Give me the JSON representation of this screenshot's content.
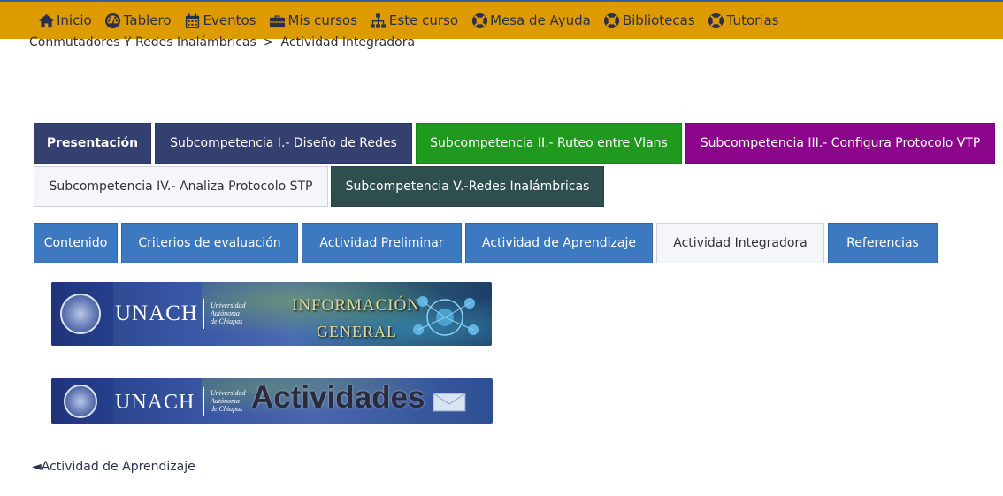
{
  "topnav": {
    "items": [
      {
        "label": "Inicio",
        "icon": "home-icon"
      },
      {
        "label": "Tablero",
        "icon": "dashboard-icon"
      },
      {
        "label": "Eventos",
        "icon": "calendar-icon"
      },
      {
        "label": "Mis cursos",
        "icon": "briefcase-icon"
      },
      {
        "label": "Este curso",
        "icon": "sitemap-icon"
      },
      {
        "label": "Mesa de Ayuda",
        "icon": "lifebuoy-icon"
      },
      {
        "label": "Bibliotecas",
        "icon": "lifebuoy-icon"
      },
      {
        "label": "Tutorias",
        "icon": "lifebuoy-icon"
      }
    ],
    "background": "#dd9b00"
  },
  "breadcrumb": {
    "course": "Conmutadores Y Redes Inalámbricas",
    "separator": ">",
    "current": "Actividad Integradora"
  },
  "section_tabs": [
    {
      "label": "Presentación",
      "bg": "#34406f",
      "color": "#ffffff",
      "bold": true
    },
    {
      "label": "Subcompetencia I.- Diseño de Redes",
      "bg": "#34406f",
      "color": "#ffffff"
    },
    {
      "label": "Subcompetencia II.- Ruteo entre Vlans",
      "bg": "#1f9a1f",
      "color": "#ffffff"
    },
    {
      "label": "Subcompetencia III.- Configura Protocolo VTP",
      "bg": "#8c068c",
      "color": "#ffffff"
    },
    {
      "label": "Subcompetencia IV.- Analiza Protocolo STP",
      "bg": "#f5f6f9",
      "color": "#333333"
    },
    {
      "label": "Subcompetencia V.-Redes Inalámbricas",
      "bg": "#2f4f4f",
      "color": "#ffffff"
    }
  ],
  "activity_tabs": [
    {
      "label": "Contenido",
      "active": false
    },
    {
      "label": "Criterios de evaluación",
      "active": false
    },
    {
      "label": "Actividad Preliminar",
      "active": false
    },
    {
      "label": "Actividad de Aprendizaje",
      "active": false
    },
    {
      "label": "Actividad Integradora",
      "active": true
    },
    {
      "label": "Referencias",
      "active": false
    }
  ],
  "colors": {
    "activity_tab_bg": "#3d79c0",
    "activity_tab_active_bg": "#f5f6f9"
  },
  "banners": [
    {
      "logo_text": "UNACH",
      "university_lines": [
        "Universidad",
        "Autónoma",
        "de Chiapas"
      ],
      "title_line1": "INFORMACIÓN",
      "title_line2": "GENERAL"
    },
    {
      "logo_text": "UNACH",
      "university_lines": [
        "Universidad",
        "Autónoma",
        "de Chiapas"
      ],
      "title_line1": "Actividades"
    }
  ],
  "back_link": {
    "arrow": "◄",
    "label": "Actividad de Aprendizaje"
  }
}
